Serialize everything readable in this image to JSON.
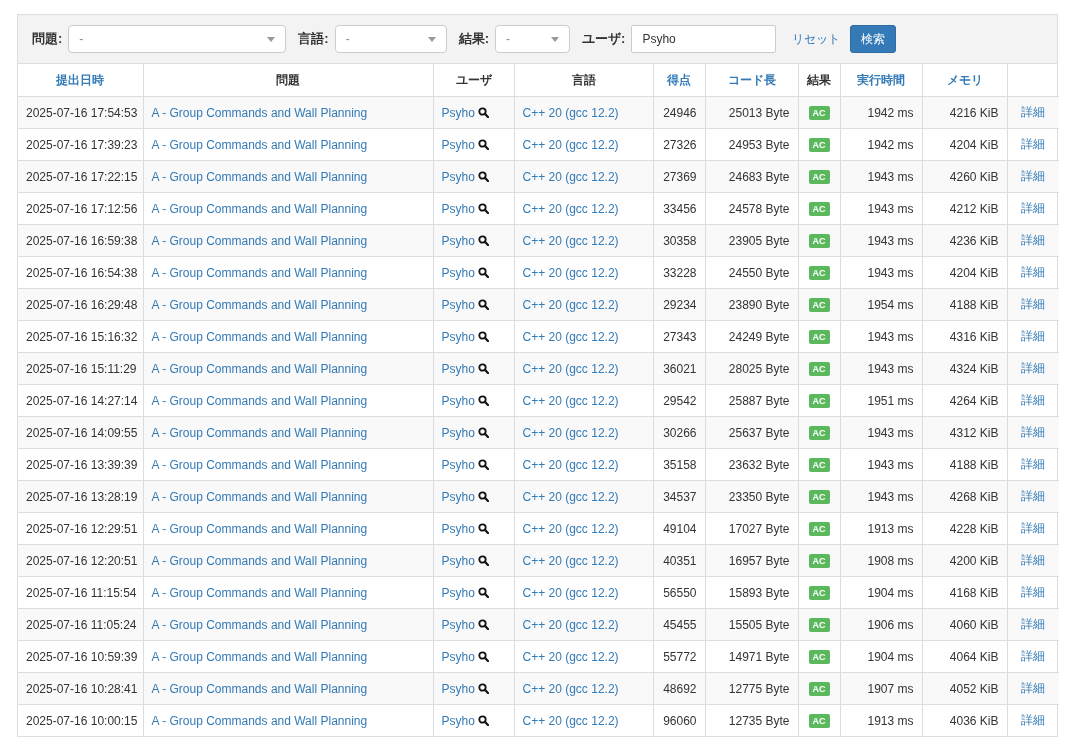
{
  "filters": [
    {
      "label": "問題:",
      "kind": "select",
      "value": "-"
    },
    {
      "label": "言語:",
      "kind": "select",
      "value": "-"
    },
    {
      "label": "結果:",
      "kind": "select",
      "value": "-"
    },
    {
      "label": "ユーザ:",
      "kind": "text",
      "value": "Psyho"
    }
  ],
  "reset_link": "リセット",
  "search_button": "検索",
  "table": {
    "columns": [
      {
        "label": "提出日時",
        "sortable": true
      },
      {
        "label": "問題",
        "sortable": false
      },
      {
        "label": "ユーザ",
        "sortable": false
      },
      {
        "label": "言語",
        "sortable": false
      },
      {
        "label": "得点",
        "sortable": true
      },
      {
        "label": "コード長",
        "sortable": true
      },
      {
        "label": "結果",
        "sortable": false
      },
      {
        "label": "実行時間",
        "sortable": true
      },
      {
        "label": "メモリ",
        "sortable": true
      }
    ],
    "rows": [
      {
        "submitted": "2025-07-16 17:54:53",
        "problem": "A - Group Commands and Wall Planning",
        "user": "Psyho",
        "language": "C++ 20 (gcc 12.2)",
        "score": "24946",
        "code_length": "25013 Byte",
        "result": "AC",
        "exec_time": "1942 ms",
        "memory": "4216 KiB",
        "detail": "詳細"
      },
      {
        "submitted": "2025-07-16 17:39:23",
        "problem": "A - Group Commands and Wall Planning",
        "user": "Psyho",
        "language": "C++ 20 (gcc 12.2)",
        "score": "27326",
        "code_length": "24953 Byte",
        "result": "AC",
        "exec_time": "1942 ms",
        "memory": "4204 KiB",
        "detail": "詳細"
      },
      {
        "submitted": "2025-07-16 17:22:15",
        "problem": "A - Group Commands and Wall Planning",
        "user": "Psyho",
        "language": "C++ 20 (gcc 12.2)",
        "score": "27369",
        "code_length": "24683 Byte",
        "result": "AC",
        "exec_time": "1943 ms",
        "memory": "4260 KiB",
        "detail": "詳細"
      },
      {
        "submitted": "2025-07-16 17:12:56",
        "problem": "A - Group Commands and Wall Planning",
        "user": "Psyho",
        "language": "C++ 20 (gcc 12.2)",
        "score": "33456",
        "code_length": "24578 Byte",
        "result": "AC",
        "exec_time": "1943 ms",
        "memory": "4212 KiB",
        "detail": "詳細"
      },
      {
        "submitted": "2025-07-16 16:59:38",
        "problem": "A - Group Commands and Wall Planning",
        "user": "Psyho",
        "language": "C++ 20 (gcc 12.2)",
        "score": "30358",
        "code_length": "23905 Byte",
        "result": "AC",
        "exec_time": "1943 ms",
        "memory": "4236 KiB",
        "detail": "詳細"
      },
      {
        "submitted": "2025-07-16 16:54:38",
        "problem": "A - Group Commands and Wall Planning",
        "user": "Psyho",
        "language": "C++ 20 (gcc 12.2)",
        "score": "33228",
        "code_length": "24550 Byte",
        "result": "AC",
        "exec_time": "1943 ms",
        "memory": "4204 KiB",
        "detail": "詳細"
      },
      {
        "submitted": "2025-07-16 16:29:48",
        "problem": "A - Group Commands and Wall Planning",
        "user": "Psyho",
        "language": "C++ 20 (gcc 12.2)",
        "score": "29234",
        "code_length": "23890 Byte",
        "result": "AC",
        "exec_time": "1954 ms",
        "memory": "4188 KiB",
        "detail": "詳細"
      },
      {
        "submitted": "2025-07-16 15:16:32",
        "problem": "A - Group Commands and Wall Planning",
        "user": "Psyho",
        "language": "C++ 20 (gcc 12.2)",
        "score": "27343",
        "code_length": "24249 Byte",
        "result": "AC",
        "exec_time": "1943 ms",
        "memory": "4316 KiB",
        "detail": "詳細"
      },
      {
        "submitted": "2025-07-16 15:11:29",
        "problem": "A - Group Commands and Wall Planning",
        "user": "Psyho",
        "language": "C++ 20 (gcc 12.2)",
        "score": "36021",
        "code_length": "28025 Byte",
        "result": "AC",
        "exec_time": "1943 ms",
        "memory": "4324 KiB",
        "detail": "詳細"
      },
      {
        "submitted": "2025-07-16 14:27:14",
        "problem": "A - Group Commands and Wall Planning",
        "user": "Psyho",
        "language": "C++ 20 (gcc 12.2)",
        "score": "29542",
        "code_length": "25887 Byte",
        "result": "AC",
        "exec_time": "1951 ms",
        "memory": "4264 KiB",
        "detail": "詳細"
      },
      {
        "submitted": "2025-07-16 14:09:55",
        "problem": "A - Group Commands and Wall Planning",
        "user": "Psyho",
        "language": "C++ 20 (gcc 12.2)",
        "score": "30266",
        "code_length": "25637 Byte",
        "result": "AC",
        "exec_time": "1943 ms",
        "memory": "4312 KiB",
        "detail": "詳細"
      },
      {
        "submitted": "2025-07-16 13:39:39",
        "problem": "A - Group Commands and Wall Planning",
        "user": "Psyho",
        "language": "C++ 20 (gcc 12.2)",
        "score": "35158",
        "code_length": "23632 Byte",
        "result": "AC",
        "exec_time": "1943 ms",
        "memory": "4188 KiB",
        "detail": "詳細"
      },
      {
        "submitted": "2025-07-16 13:28:19",
        "problem": "A - Group Commands and Wall Planning",
        "user": "Psyho",
        "language": "C++ 20 (gcc 12.2)",
        "score": "34537",
        "code_length": "23350 Byte",
        "result": "AC",
        "exec_time": "1943 ms",
        "memory": "4268 KiB",
        "detail": "詳細"
      },
      {
        "submitted": "2025-07-16 12:29:51",
        "problem": "A - Group Commands and Wall Planning",
        "user": "Psyho",
        "language": "C++ 20 (gcc 12.2)",
        "score": "49104",
        "code_length": "17027 Byte",
        "result": "AC",
        "exec_time": "1913 ms",
        "memory": "4228 KiB",
        "detail": "詳細"
      },
      {
        "submitted": "2025-07-16 12:20:51",
        "problem": "A - Group Commands and Wall Planning",
        "user": "Psyho",
        "language": "C++ 20 (gcc 12.2)",
        "score": "40351",
        "code_length": "16957 Byte",
        "result": "AC",
        "exec_time": "1908 ms",
        "memory": "4200 KiB",
        "detail": "詳細"
      },
      {
        "submitted": "2025-07-16 11:15:54",
        "problem": "A - Group Commands and Wall Planning",
        "user": "Psyho",
        "language": "C++ 20 (gcc 12.2)",
        "score": "56550",
        "code_length": "15893 Byte",
        "result": "AC",
        "exec_time": "1904 ms",
        "memory": "4168 KiB",
        "detail": "詳細"
      },
      {
        "submitted": "2025-07-16 11:05:24",
        "problem": "A - Group Commands and Wall Planning",
        "user": "Psyho",
        "language": "C++ 20 (gcc 12.2)",
        "score": "45455",
        "code_length": "15505 Byte",
        "result": "AC",
        "exec_time": "1906 ms",
        "memory": "4060 KiB",
        "detail": "詳細"
      },
      {
        "submitted": "2025-07-16 10:59:39",
        "problem": "A - Group Commands and Wall Planning",
        "user": "Psyho",
        "language": "C++ 20 (gcc 12.2)",
        "score": "55772",
        "code_length": "14971 Byte",
        "result": "AC",
        "exec_time": "1904 ms",
        "memory": "4064 KiB",
        "detail": "詳細"
      },
      {
        "submitted": "2025-07-16 10:28:41",
        "problem": "A - Group Commands and Wall Planning",
        "user": "Psyho",
        "language": "C++ 20 (gcc 12.2)",
        "score": "48692",
        "code_length": "12775 Byte",
        "result": "AC",
        "exec_time": "1907 ms",
        "memory": "4052 KiB",
        "detail": "詳細"
      },
      {
        "submitted": "2025-07-16 10:00:15",
        "problem": "A - Group Commands and Wall Planning",
        "user": "Psyho",
        "language": "C++ 20 (gcc 12.2)",
        "score": "96060",
        "code_length": "12735 Byte",
        "result": "AC",
        "exec_time": "1913 ms",
        "memory": "4036 KiB",
        "detail": "詳細"
      }
    ]
  }
}
